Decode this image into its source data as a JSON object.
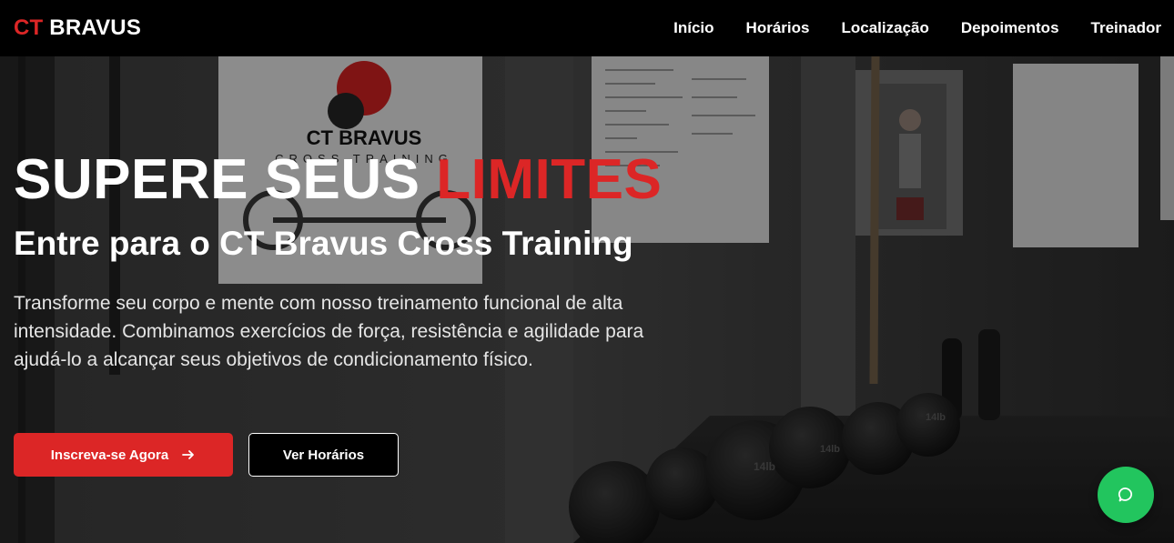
{
  "brand": {
    "accent": "CT",
    "name": "BRAVUS",
    "accent_color": "#dc2626"
  },
  "nav": {
    "items": [
      {
        "label": "Início"
      },
      {
        "label": "Horários"
      },
      {
        "label": "Localização"
      },
      {
        "label": "Depoimentos"
      },
      {
        "label": "Treinador"
      }
    ]
  },
  "hero": {
    "title_main": "SUPERE SEUS",
    "title_accent": "LIMITES",
    "subtitle": "Entre para o CT Bravus Cross Training",
    "description": "Transforme seu corpo e mente com nosso treinamento funcional de alta intensidade. Combinamos exercícios de força, resistência e agilidade para ajudá-lo a alcançar seus objetivos de condicionamento físico.",
    "primary_button": "Inscreva-se Agora",
    "primary_icon": "arrow-right-icon",
    "secondary_button": "Ver Horários",
    "background_poster": {
      "line1": "CT BRAVUS",
      "line2": "CROSS TRAINING"
    },
    "background_balls": [
      "14lb",
      "14lb",
      "14lb"
    ]
  },
  "chat_fab": {
    "icon": "chat-bubble-icon",
    "color": "#22c55e"
  }
}
